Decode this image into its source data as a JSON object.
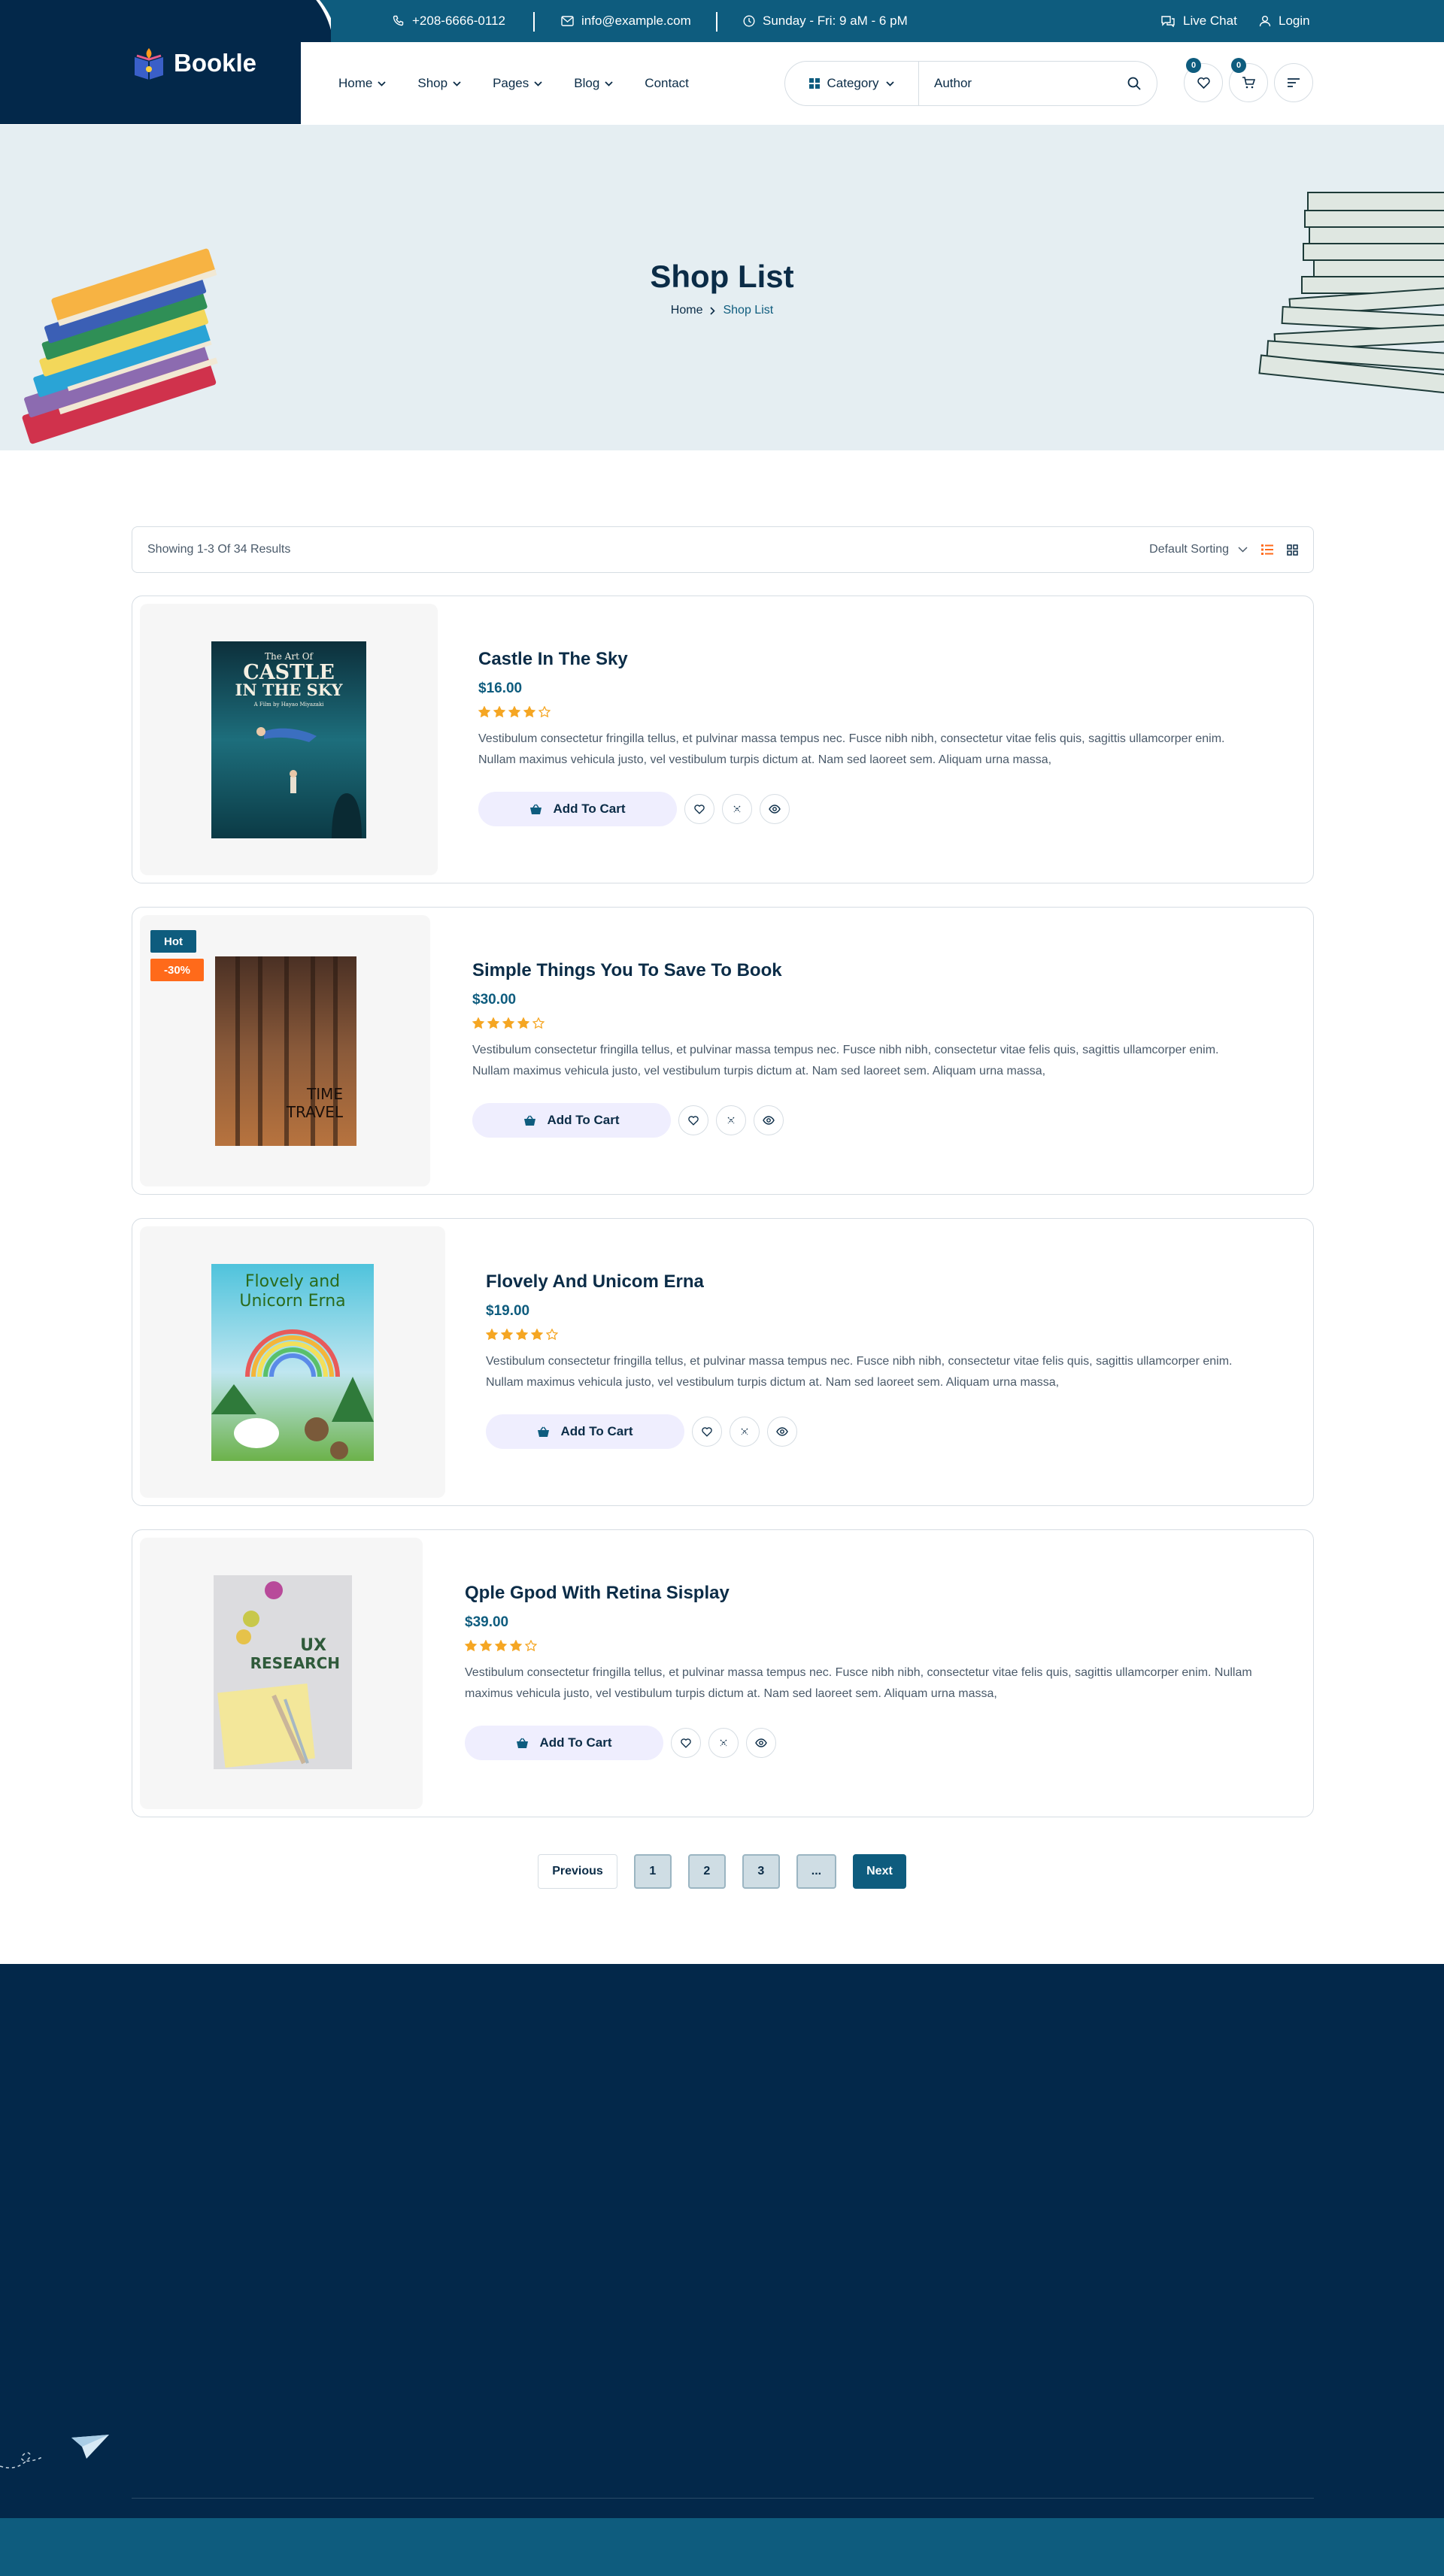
{
  "topbar": {
    "phone": "+208-6666-0112",
    "email": "info@example.com",
    "hours": "Sunday - Fri: 9 aM - 6 pM",
    "live_chat": "Live Chat",
    "login": "Login"
  },
  "brand": {
    "name": "Bookle"
  },
  "nav": {
    "items": [
      {
        "label": "Home"
      },
      {
        "label": "Shop"
      },
      {
        "label": "Pages"
      },
      {
        "label": "Blog"
      },
      {
        "label": "Contact"
      }
    ]
  },
  "search": {
    "category": "Category",
    "author": "Author"
  },
  "header_icons": {
    "wishlist_count": "0",
    "cart_count": "0"
  },
  "hero": {
    "title": "Shop List",
    "crumb_home": "Home",
    "crumb_current": "Shop List"
  },
  "toolbar": {
    "results": "Showing 1-3 Of 34 Results",
    "sorting": "Default Sorting"
  },
  "products": [
    {
      "title": "Castle In The Sky",
      "price": "$16.00",
      "rating": 4,
      "cart_label": "Add To Cart",
      "description": "Vestibulum consectetur fringilla tellus, et pulvinar massa tempus nec. Fusce nibh nibh, consectetur vitae felis quis, sagittis ullamcorper enim. Nullam maximus vehicula justo, vel vestibulum turpis dictum at. Nam sed laoreet sem. Aliquam urna massa,",
      "cover_text": [
        "The Art Of",
        "CASTLE",
        "IN THE SKY",
        "A Film by Hayao Miyazaki"
      ]
    },
    {
      "title": "Simple Things You To Save To Book",
      "price": "$30.00",
      "rating": 4,
      "cart_label": "Add To Cart",
      "description": "Vestibulum consectetur fringilla tellus, et pulvinar massa tempus nec. Fusce nibh nibh, consectetur vitae felis quis, sagittis ullamcorper enim. Nullam maximus vehicula justo, vel vestibulum turpis dictum at. Nam sed laoreet sem. Aliquam urna massa,",
      "tag_hot": "Hot",
      "tag_sale": "-30%",
      "cover_text": [
        "TIME",
        "TRAVEL"
      ]
    },
    {
      "title": "Flovely And Unicom Erna",
      "price": "$19.00",
      "rating": 4,
      "cart_label": "Add To Cart",
      "description": "Vestibulum consectetur fringilla tellus, et pulvinar massa tempus nec. Fusce nibh nibh, consectetur vitae felis quis, sagittis ullamcorper enim. Nullam maximus vehicula justo, vel vestibulum turpis dictum at. Nam sed laoreet sem. Aliquam urna massa,",
      "cover_text": [
        "Flovely and",
        "Unicorn Erna"
      ]
    },
    {
      "title": "Qple Gpod With Retina Sisplay",
      "price": "$39.00",
      "rating": 4,
      "cart_label": "Add To Cart",
      "description": "Vestibulum consectetur fringilla tellus, et pulvinar massa tempus nec. Fusce nibh nibh, consectetur vitae felis quis, sagittis ullamcorper enim. Nullam maximus vehicula justo, vel vestibulum turpis dictum at. Nam sed laoreet sem. Aliquam urna massa,",
      "cover_text": [
        "UX",
        "RESEARCH"
      ]
    }
  ],
  "pagination": {
    "prev": "Previous",
    "pages": [
      "1",
      "2",
      "3",
      "..."
    ],
    "next": "Next"
  },
  "colors": {
    "primary": "#0e5c7e",
    "dark": "#03284a",
    "accent": "#ff6a1a",
    "star": "#f5a623",
    "hero_bg": "#e5eef2"
  }
}
